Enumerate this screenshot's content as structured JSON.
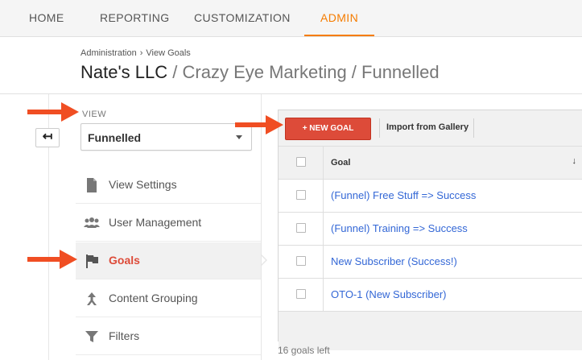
{
  "nav": {
    "tabs": [
      {
        "label": "HOME",
        "active": false
      },
      {
        "label": "REPORTING",
        "active": false
      },
      {
        "label": "CUSTOMIZATION",
        "active": false
      },
      {
        "label": "ADMIN",
        "active": true
      }
    ]
  },
  "breadcrumb": {
    "items": [
      "Administration",
      "View Goals"
    ],
    "separator": "›"
  },
  "header": {
    "account": "Nate's LLC",
    "path": "/ Crazy Eye Marketing / Funnelled"
  },
  "sidebar": {
    "back_icon": "back-arrow-icon",
    "view_label": "VIEW",
    "view_selected": "Funnelled",
    "items": [
      {
        "label": "View Settings",
        "icon": "document-icon",
        "selected": false
      },
      {
        "label": "User Management",
        "icon": "users-icon",
        "selected": false
      },
      {
        "label": "Goals",
        "icon": "flag-icon",
        "selected": true
      },
      {
        "label": "Content Grouping",
        "icon": "content-grouping-icon",
        "selected": false
      },
      {
        "label": "Filters",
        "icon": "filter-icon",
        "selected": false
      }
    ]
  },
  "toolbar": {
    "new_goal_label": "+ NEW GOAL",
    "import_label": "Import from Gallery"
  },
  "table": {
    "header": "Goal",
    "sort_icon": "sort-down-icon",
    "rows": [
      "(Funnel) Free Stuff => Success",
      "(Funnel) Training => Success",
      "New Subscriber (Success!)",
      "OTO-1 (New Subscriber)"
    ]
  },
  "footer": {
    "goals_left": "16 goals left"
  },
  "colors": {
    "accent": "#f57c00",
    "new_goal_button": "#dd4b39",
    "link": "#3367d6",
    "annotation_arrow": "#f04e23"
  }
}
